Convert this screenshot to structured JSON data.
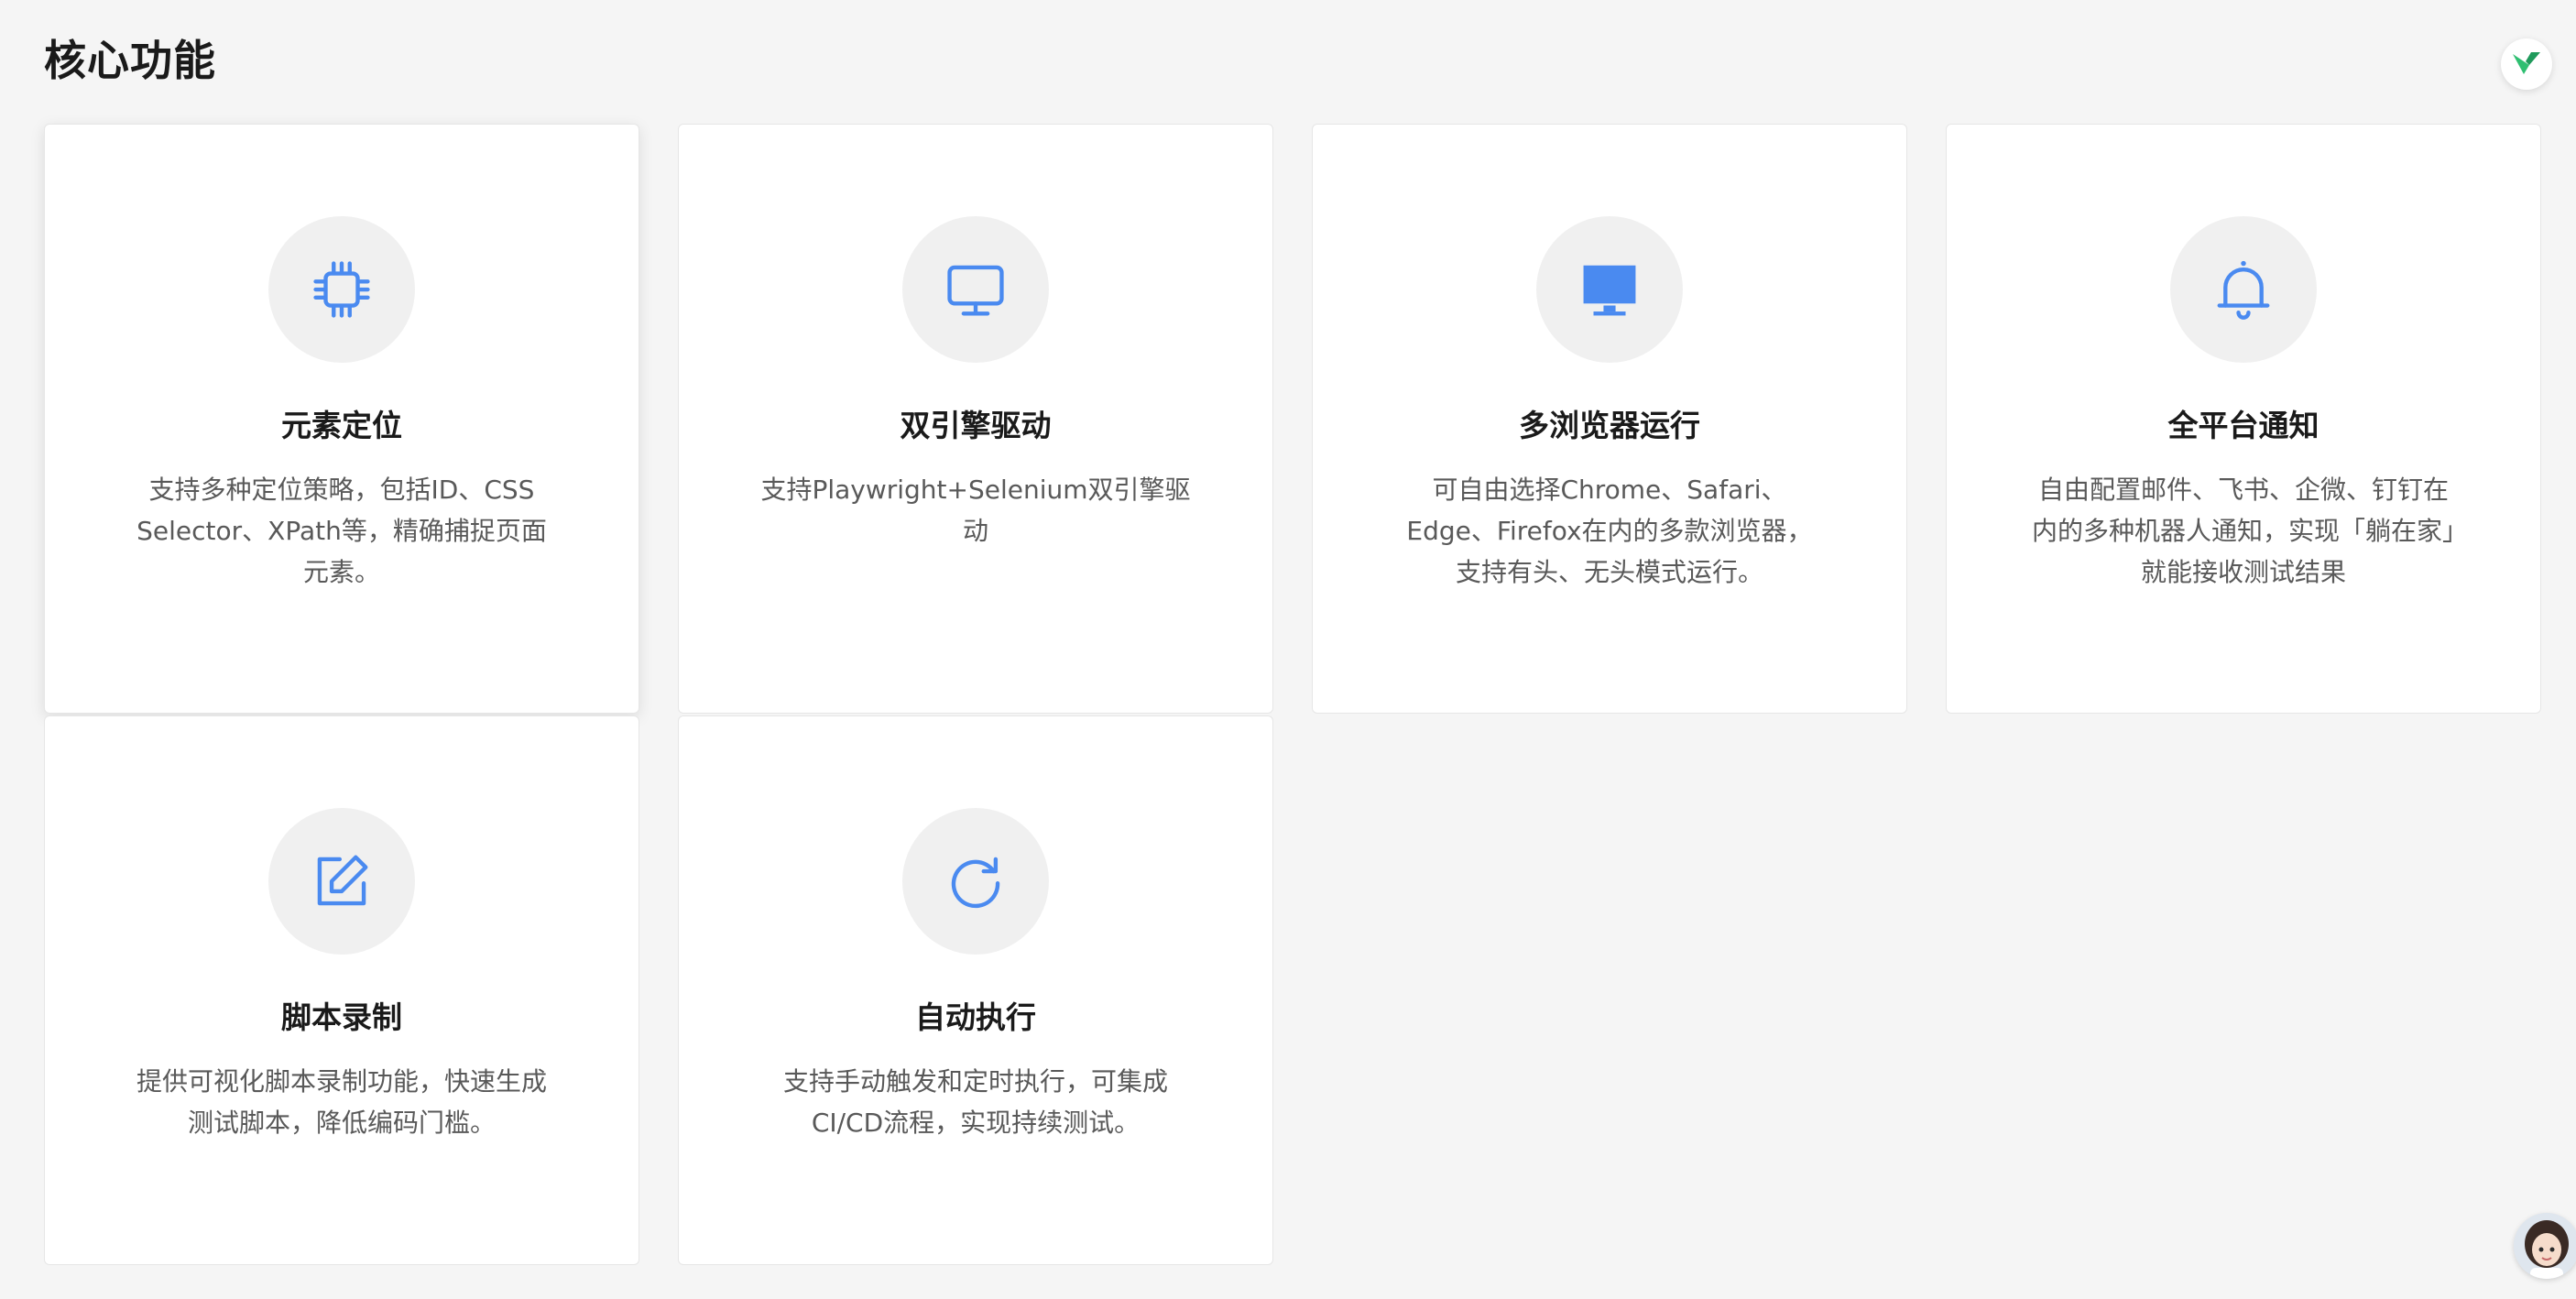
{
  "page": {
    "title": "核心功能"
  },
  "colors": {
    "accent": "#4a8af0",
    "icon_bg": "#f0f0f0",
    "card_bg": "#ffffff",
    "page_bg": "#f5f5f5"
  },
  "features": [
    {
      "icon": "cpu-chip-icon",
      "title": "元素定位",
      "description": "支持多种定位策略，包括ID、CSS Selector、XPath等，精确捕捉页面元素。"
    },
    {
      "icon": "monitor-outline-icon",
      "title": "双引擎驱动",
      "description": "支持Playwright+Selenium双引擎驱动"
    },
    {
      "icon": "monitor-filled-icon",
      "title": "多浏览器运行",
      "description": "可自由选择Chrome、Safari、Edge、Firefox在内的多款浏览器，支持有头、无头模式运行。"
    },
    {
      "icon": "bell-icon",
      "title": "全平台通知",
      "description": "自由配置邮件、飞书、企微、钉钉在内的多种机器人通知，实现「躺在家」就能接收测试结果"
    },
    {
      "icon": "edit-icon",
      "title": "脚本录制",
      "description": "提供可视化脚本录制功能，快速生成测试脚本，降低编码门槛。"
    },
    {
      "icon": "refresh-icon",
      "title": "自动执行",
      "description": "支持手动触发和定时执行，可集成CI/CD流程，实现持续测试。"
    }
  ]
}
